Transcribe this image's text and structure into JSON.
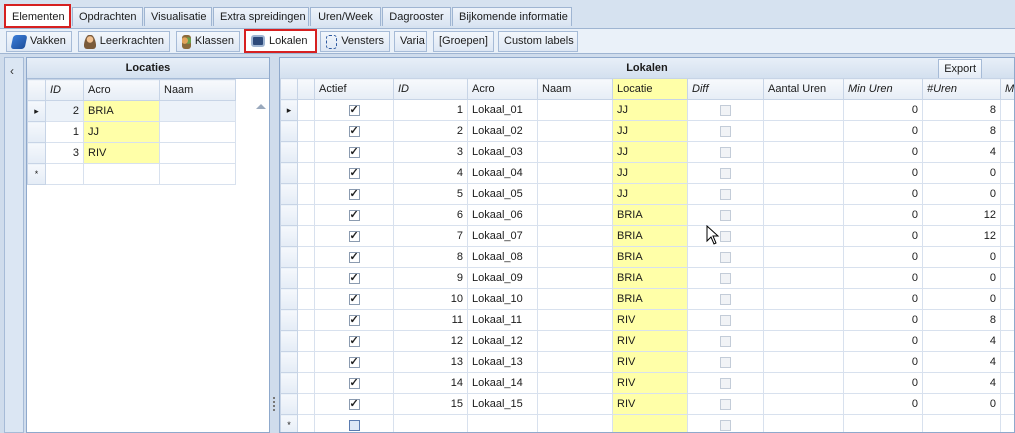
{
  "tabs_top": [
    {
      "label": "Elementen",
      "active": true
    },
    {
      "label": "Opdrachten"
    },
    {
      "label": "Visualisatie"
    },
    {
      "label": "Extra spreidingen"
    },
    {
      "label": "Uren/Week"
    },
    {
      "label": "Dagrooster"
    },
    {
      "label": "Bijkomende informatie"
    }
  ],
  "tabs_sub": [
    {
      "label": "Vakken",
      "icon": "book-icon"
    },
    {
      "label": "Leerkrachten",
      "icon": "person-icon"
    },
    {
      "label": "Klassen",
      "icon": "group-icon"
    },
    {
      "label": "Lokalen",
      "icon": "room-icon",
      "active": true
    },
    {
      "label": "Vensters",
      "icon": "window-icon"
    },
    {
      "label": "Varia"
    },
    {
      "label": "[Groepen]"
    },
    {
      "label": "Custom labels"
    }
  ],
  "collapse_glyph": "‹",
  "locaties": {
    "title": "Locaties",
    "columns": [
      "ID",
      "Acro",
      "Naam"
    ],
    "rows": [
      {
        "id": "2",
        "acro": "BRIA",
        "naam": ""
      },
      {
        "id": "1",
        "acro": "JJ",
        "naam": ""
      },
      {
        "id": "3",
        "acro": "RIV",
        "naam": ""
      }
    ],
    "new_row_marker": "*",
    "current_marker": "▸"
  },
  "lokalen": {
    "title": "Lokalen",
    "export_label": "Export",
    "columns": [
      "Actief",
      "ID",
      "Acro",
      "Naam",
      "Locatie",
      "Diff",
      "Aantal Uren",
      "Min Uren",
      "#Uren",
      "Ma"
    ],
    "rows": [
      {
        "actief": true,
        "id": "1",
        "acro": "Lokaal_01",
        "naam": "",
        "locatie": "JJ",
        "aantal": "",
        "min": "0",
        "uren": "8"
      },
      {
        "actief": true,
        "id": "2",
        "acro": "Lokaal_02",
        "naam": "",
        "locatie": "JJ",
        "aantal": "",
        "min": "0",
        "uren": "8"
      },
      {
        "actief": true,
        "id": "3",
        "acro": "Lokaal_03",
        "naam": "",
        "locatie": "JJ",
        "aantal": "",
        "min": "0",
        "uren": "4"
      },
      {
        "actief": true,
        "id": "4",
        "acro": "Lokaal_04",
        "naam": "",
        "locatie": "JJ",
        "aantal": "",
        "min": "0",
        "uren": "0"
      },
      {
        "actief": true,
        "id": "5",
        "acro": "Lokaal_05",
        "naam": "",
        "locatie": "JJ",
        "aantal": "",
        "min": "0",
        "uren": "0"
      },
      {
        "actief": true,
        "id": "6",
        "acro": "Lokaal_06",
        "naam": "",
        "locatie": "BRIA",
        "aantal": "",
        "min": "0",
        "uren": "12"
      },
      {
        "actief": true,
        "id": "7",
        "acro": "Lokaal_07",
        "naam": "",
        "locatie": "BRIA",
        "aantal": "",
        "min": "0",
        "uren": "12"
      },
      {
        "actief": true,
        "id": "8",
        "acro": "Lokaal_08",
        "naam": "",
        "locatie": "BRIA",
        "aantal": "",
        "min": "0",
        "uren": "0"
      },
      {
        "actief": true,
        "id": "9",
        "acro": "Lokaal_09",
        "naam": "",
        "locatie": "BRIA",
        "aantal": "",
        "min": "0",
        "uren": "0"
      },
      {
        "actief": true,
        "id": "10",
        "acro": "Lokaal_10",
        "naam": "",
        "locatie": "BRIA",
        "aantal": "",
        "min": "0",
        "uren": "0"
      },
      {
        "actief": true,
        "id": "11",
        "acro": "Lokaal_11",
        "naam": "",
        "locatie": "RIV",
        "aantal": "",
        "min": "0",
        "uren": "8"
      },
      {
        "actief": true,
        "id": "12",
        "acro": "Lokaal_12",
        "naam": "",
        "locatie": "RIV",
        "aantal": "",
        "min": "0",
        "uren": "4"
      },
      {
        "actief": true,
        "id": "13",
        "acro": "Lokaal_13",
        "naam": "",
        "locatie": "RIV",
        "aantal": "",
        "min": "0",
        "uren": "4"
      },
      {
        "actief": true,
        "id": "14",
        "acro": "Lokaal_14",
        "naam": "",
        "locatie": "RIV",
        "aantal": "",
        "min": "0",
        "uren": "4"
      },
      {
        "actief": true,
        "id": "15",
        "acro": "Lokaal_15",
        "naam": "",
        "locatie": "RIV",
        "aantal": "",
        "min": "0",
        "uren": "0"
      }
    ],
    "new_row_marker": "*",
    "current_marker": "▸"
  },
  "colors": {
    "highlight": "#ffffa8",
    "active_tab_border": "#d62020"
  }
}
